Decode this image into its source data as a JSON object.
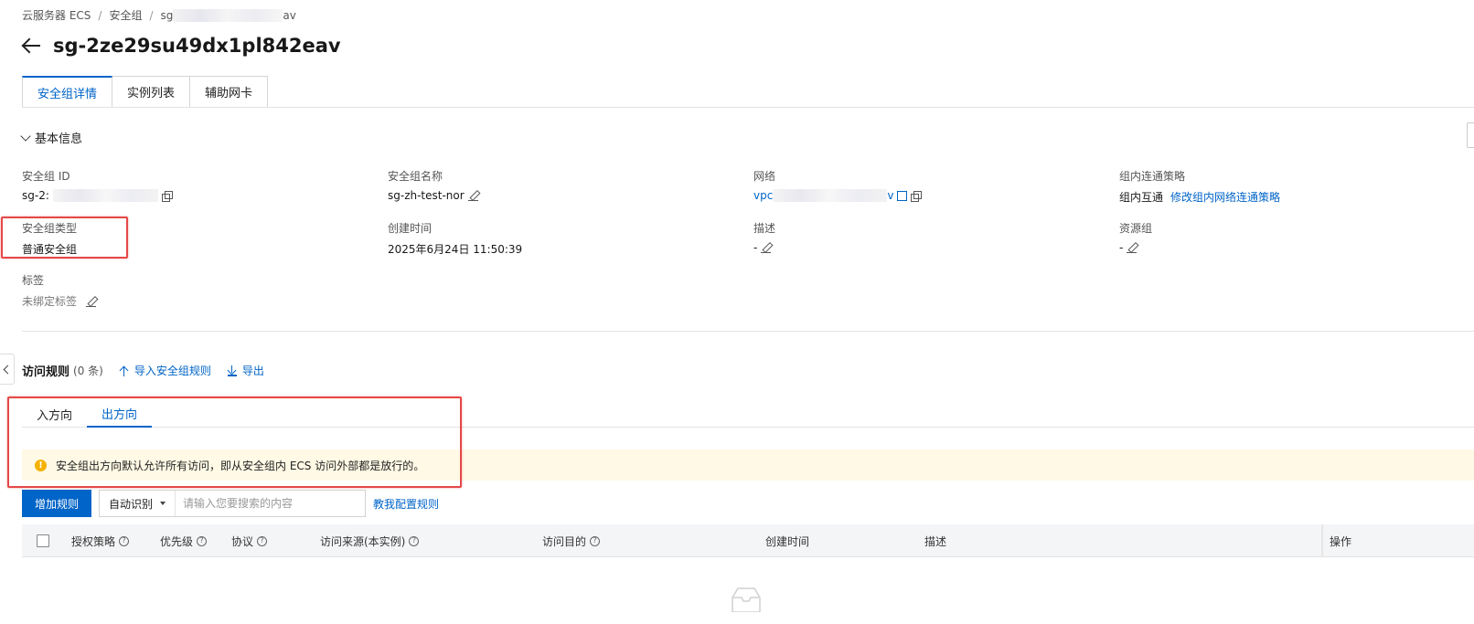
{
  "breadcrumb": {
    "root": "云服务器 ECS",
    "sep": "/",
    "level2": "安全组",
    "current_prefix": "sg",
    "current_suffix": "av"
  },
  "header": {
    "title": "sg-2ze29su49dx1pl842eav"
  },
  "tabs": [
    {
      "label": "安全组详情"
    },
    {
      "label": "实例列表"
    },
    {
      "label": "辅助网卡"
    }
  ],
  "basic_info": {
    "section_title": "基本信息",
    "sg_id": {
      "label": "安全组 ID",
      "value_prefix": "sg-2:"
    },
    "sg_name": {
      "label": "安全组名称",
      "value": "sg-zh-test-nor"
    },
    "network": {
      "label": "网络",
      "value_prefix": "vpc",
      "value_suffix": "v"
    },
    "intra_policy": {
      "label": "组内连通策略",
      "value": "组内互通",
      "edit_link": "修改组内网络连通策略"
    },
    "sg_type": {
      "label": "安全组类型",
      "value": "普通安全组"
    },
    "created": {
      "label": "创建时间",
      "value": "2025年6月24日 11:50:39"
    },
    "description": {
      "label": "描述",
      "value": "-"
    },
    "resource_group": {
      "label": "资源组",
      "value": "-"
    },
    "tags": {
      "label": "标签",
      "value": "未绑定标签"
    }
  },
  "rules": {
    "title": "访问规则",
    "count": "(0 条)",
    "import_label": "导入安全组规则",
    "export_label": "导出",
    "directions": [
      {
        "label": "入方向"
      },
      {
        "label": "出方向"
      }
    ],
    "alert": "安全组出方向默认允许所有访问，即从安全组内 ECS 访问外部都是放行的。",
    "add_button": "增加规则",
    "search_mode": "自动识别",
    "search_placeholder": "请输入您要搜索的内容",
    "help_link": "教我配置规则",
    "columns": {
      "policy": "授权策略",
      "priority": "优先级",
      "protocol": "协议",
      "source": "访问来源(本实例)",
      "destination": "访问目的",
      "created": "创建时间",
      "description": "描述",
      "actions": "操作"
    }
  },
  "colors": {
    "accent": "#0064c8",
    "highlight": "#e54848",
    "alert_bg": "#fff9e5"
  }
}
